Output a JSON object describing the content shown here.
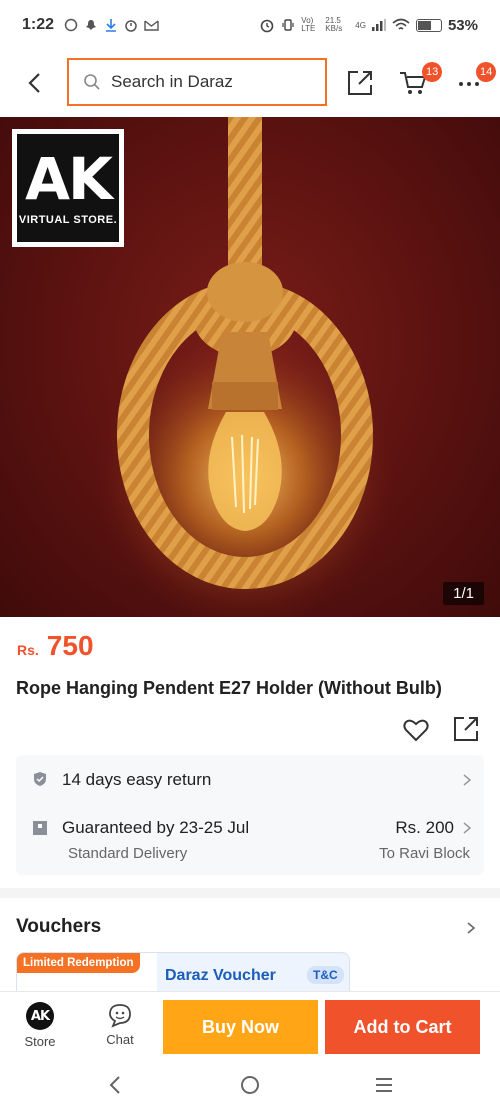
{
  "status_bar": {
    "time": "1:22",
    "network": "Vo) LTE",
    "speed": "21.5 KB/s",
    "signal": "4G",
    "battery": "53%"
  },
  "header": {
    "search_placeholder": "Search in Daraz",
    "cart_count": "13",
    "more_count": "14"
  },
  "gallery": {
    "store_logo_text": "AK",
    "store_logo_sub": "VIRTUAL STORE.",
    "counter": "1/1"
  },
  "product": {
    "currency": "Rs.",
    "price": "750",
    "title": "Rope Hanging Pendent E27 Holder (Without Bulb)"
  },
  "services": {
    "return": "14 days easy return",
    "delivery_main": "Guaranteed by 23-25 Jul",
    "delivery_type": "Standard Delivery",
    "delivery_fee": "Rs. 200",
    "delivery_to": "To Ravi Block"
  },
  "vouchers": {
    "title": "Vouchers",
    "tag": "Limited Redemption",
    "name": "Daraz Voucher",
    "tc": "T&C"
  },
  "bottom_bar": {
    "store_label": "Store",
    "chat_label": "Chat",
    "buy_now": "Buy Now",
    "add_to_cart": "Add to Cart",
    "store_avatar": "AK"
  },
  "colors": {
    "accent": "#f57224",
    "price": "#f0522b",
    "buy_now": "#ffa516",
    "add_to_cart": "#f0522b",
    "voucher_blue": "#1a5dba"
  }
}
